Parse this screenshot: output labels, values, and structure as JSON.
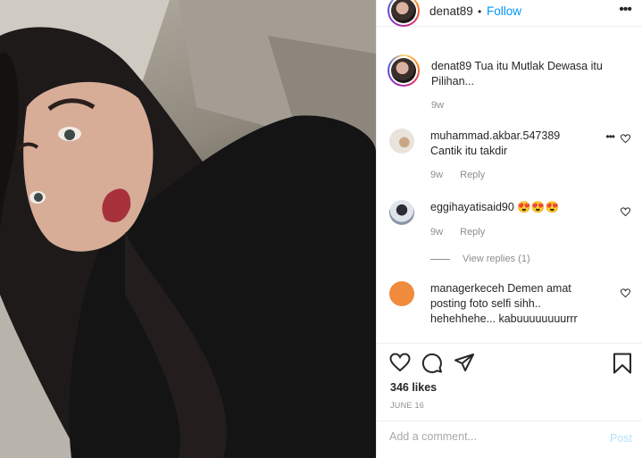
{
  "post": {
    "username": "denat89",
    "dot": "•",
    "follow_label": "Follow",
    "more_label": "•••"
  },
  "caption": {
    "username": "denat89",
    "text": "Tua itu Mutlak Dewasa itu Pilihan...",
    "age": "9w"
  },
  "comments": [
    {
      "username": "muhammad.akbar.547389",
      "text": "Cantik itu takdir",
      "age": "9w",
      "reply_label": "Reply",
      "more_label": "•••"
    },
    {
      "username": "eggihayatisaid90",
      "text": "😍😍😍",
      "age": "9w",
      "reply_label": "Reply"
    },
    {
      "username": "managerkeceh",
      "text": "Demen amat posting foto selfi sihh.. hehehhehe... kabuuuuuuuurrr"
    }
  ],
  "view_replies_label": "View replies (1)",
  "likes": "346 likes",
  "date": "JUNE 16",
  "comment_box": {
    "placeholder": "Add a comment...",
    "post_label": "Post"
  },
  "icons": [
    "heart-icon",
    "comment-icon",
    "share-icon",
    "bookmark-icon"
  ],
  "colors": {
    "link": "#0095f6",
    "muted": "#8e8e8e",
    "post_disabled": "#b2dffc"
  }
}
